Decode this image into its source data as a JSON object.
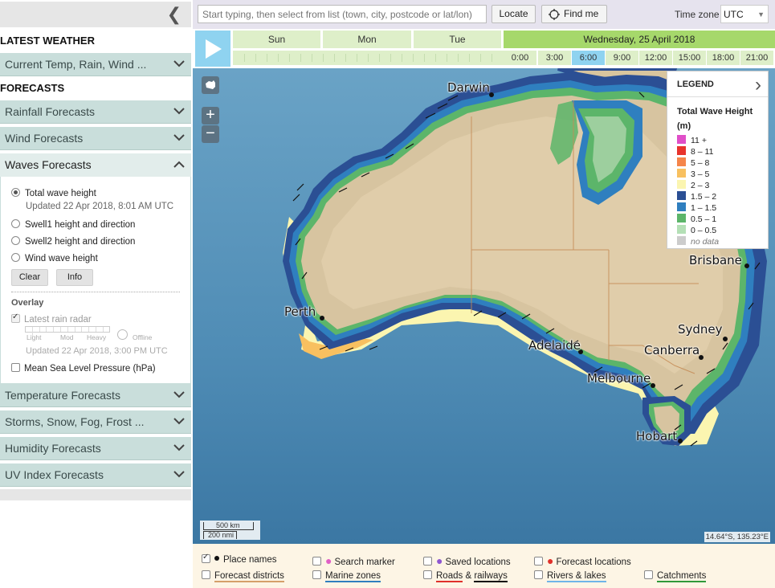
{
  "sidebar": {
    "latest_title": "LATEST WEATHER",
    "current": "Current Temp, Rain, Wind ...",
    "forecasts_title": "FORECASTS",
    "rainfall": "Rainfall Forecasts",
    "wind": "Wind Forecasts",
    "waves": "Waves Forecasts",
    "options": [
      {
        "label": "Total wave height",
        "selected": true
      },
      {
        "label": "Swell1 height and direction",
        "selected": false
      },
      {
        "label": "Swell2 height and direction",
        "selected": false
      },
      {
        "label": "Wind wave height",
        "selected": false
      }
    ],
    "updated": "Updated 22 Apr 2018, 8:01 AM UTC",
    "clear": "Clear",
    "info": "Info",
    "overlay_title": "Overlay",
    "rain_radar": "Latest rain radar",
    "radar_light": "Light",
    "radar_mod": "Mod",
    "radar_heavy": "Heavy",
    "radar_offline": "Offline",
    "radar_updated": "Updated 22 Apr 2018, 3:00 PM UTC",
    "mslp": "Mean Sea Level Pressure (hPa)",
    "temperature": "Temperature Forecasts",
    "storms": "Storms, Snow, Fog, Frost ...",
    "humidity": "Humidity Forecasts",
    "uv": "UV Index Forecasts"
  },
  "toolbar": {
    "search_placeholder": "Start typing, then select from list (town, city, postcode or lat/lon)",
    "locate": "Locate",
    "find_me": "Find me",
    "tz_label": "Time zone",
    "tz_value": "UTC"
  },
  "timeline": {
    "days": [
      "Sun",
      "Mon",
      "Tue"
    ],
    "active_day": "Wednesday, 25 April 2018",
    "hours": [
      "0:00",
      "3:00",
      "6:00",
      "9:00",
      "12:00",
      "15:00",
      "18:00",
      "21:00"
    ],
    "selected_hour": "6:00"
  },
  "map": {
    "places": {
      "darwin": "Darwin",
      "perth": "Perth",
      "adelaide": "Adelaide",
      "melbourne": "Melbourne",
      "canberra": "Canberra",
      "sydney": "Sydney",
      "brisbane": "Brisbane",
      "hobart": "Hobart"
    },
    "scale_km": "500 km",
    "scale_nmi": "200 nmi",
    "coords": "14.64°S, 135.23°E"
  },
  "legend": {
    "title": "LEGEND",
    "subtitle": "Total Wave Height (m)",
    "items": [
      {
        "label": "11 +",
        "color": "#e04fc8"
      },
      {
        "label": "8 – 11",
        "color": "#e8332c"
      },
      {
        "label": "5 – 8",
        "color": "#f5854a"
      },
      {
        "label": "3 – 5",
        "color": "#f8c060"
      },
      {
        "label": "2 – 3",
        "color": "#fbf5b0"
      },
      {
        "label": "1.5 – 2",
        "color": "#2b4f94"
      },
      {
        "label": "1 – 1.5",
        "color": "#2f7fbf"
      },
      {
        "label": "0.5 – 1",
        "color": "#5cb56a"
      },
      {
        "label": "0 – 0.5",
        "color": "#b4e0b6"
      },
      {
        "label": "no data",
        "color": "#cccccc"
      }
    ]
  },
  "overlays": {
    "place_names": "Place names",
    "search_marker": "Search marker",
    "saved_locations": "Saved locations",
    "forecast_locations": "Forecast locations",
    "forecast_districts": "Forecast districts",
    "marine_zones": "Marine zones",
    "roads": "Roads",
    "amp": "&",
    "railways": "railways",
    "rivers": "Rivers & lakes",
    "catchments": "Catchments"
  }
}
